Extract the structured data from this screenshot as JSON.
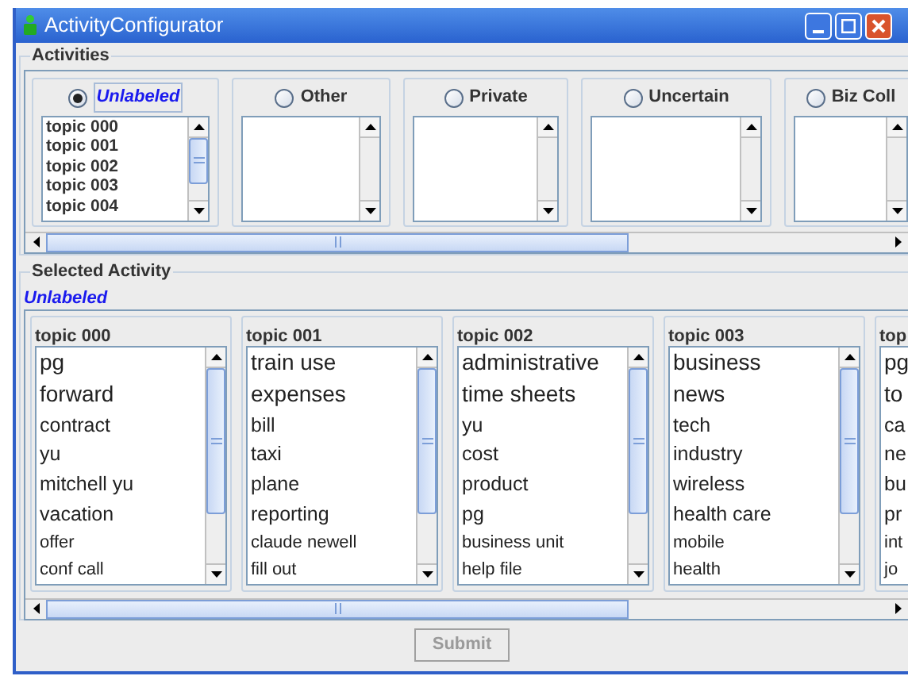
{
  "window": {
    "title": "ActivityConfigurator"
  },
  "activities": {
    "legend": "Activities",
    "items": [
      {
        "label": "Unlabeled",
        "selected": true,
        "topics": [
          "topic 000",
          "topic 001",
          "topic 002",
          "topic 003",
          "topic 004"
        ]
      },
      {
        "label": "Other",
        "selected": false
      },
      {
        "label": "Private",
        "selected": false
      },
      {
        "label": "Uncertain",
        "selected": false
      },
      {
        "label": "Biz Coll",
        "selected": false
      }
    ]
  },
  "selected_activity": {
    "legend": "Selected Activity",
    "name": "Unlabeled",
    "topics": [
      {
        "title": "topic 000",
        "terms": [
          {
            "text": "pg",
            "kind": "major"
          },
          {
            "text": "forward",
            "kind": "major"
          },
          {
            "text": "contract",
            "kind": "mid"
          },
          {
            "text": "yu",
            "kind": "mid"
          },
          {
            "text": "mitchell yu",
            "kind": "mid"
          },
          {
            "text": "vacation",
            "kind": "mid"
          },
          {
            "text": "offer",
            "kind": "minor"
          },
          {
            "text": "conf call",
            "kind": "minor"
          }
        ]
      },
      {
        "title": "topic 001",
        "terms": [
          {
            "text": "train use",
            "kind": "major"
          },
          {
            "text": "expenses",
            "kind": "major"
          },
          {
            "text": "bill",
            "kind": "mid"
          },
          {
            "text": "taxi",
            "kind": "mid"
          },
          {
            "text": "plane",
            "kind": "mid"
          },
          {
            "text": "reporting",
            "kind": "mid"
          },
          {
            "text": "claude newell",
            "kind": "minor"
          },
          {
            "text": "fill out",
            "kind": "minor"
          }
        ]
      },
      {
        "title": "topic 002",
        "terms": [
          {
            "text": "administrative",
            "kind": "major"
          },
          {
            "text": "time sheets",
            "kind": "major"
          },
          {
            "text": "yu",
            "kind": "mid"
          },
          {
            "text": "cost",
            "kind": "mid"
          },
          {
            "text": "product",
            "kind": "mid"
          },
          {
            "text": "pg",
            "kind": "mid"
          },
          {
            "text": "business unit",
            "kind": "minor"
          },
          {
            "text": "help file",
            "kind": "minor"
          }
        ]
      },
      {
        "title": "topic 003",
        "terms": [
          {
            "text": "business",
            "kind": "major"
          },
          {
            "text": "news",
            "kind": "major"
          },
          {
            "text": "tech",
            "kind": "mid"
          },
          {
            "text": "industry",
            "kind": "mid"
          },
          {
            "text": "wireless",
            "kind": "mid"
          },
          {
            "text": "health care",
            "kind": "mid"
          },
          {
            "text": "mobile",
            "kind": "minor"
          },
          {
            "text": "health",
            "kind": "minor"
          }
        ]
      },
      {
        "title": "top",
        "terms": [
          {
            "text": "pg",
            "kind": "major"
          },
          {
            "text": "to",
            "kind": "major"
          },
          {
            "text": "ca",
            "kind": "mid"
          },
          {
            "text": "ne",
            "kind": "mid"
          },
          {
            "text": "bu",
            "kind": "mid"
          },
          {
            "text": "pr",
            "kind": "mid"
          },
          {
            "text": "int",
            "kind": "minor"
          },
          {
            "text": "jo",
            "kind": "minor"
          }
        ]
      }
    ]
  },
  "submit": {
    "label": "Submit",
    "disabled": true
  }
}
